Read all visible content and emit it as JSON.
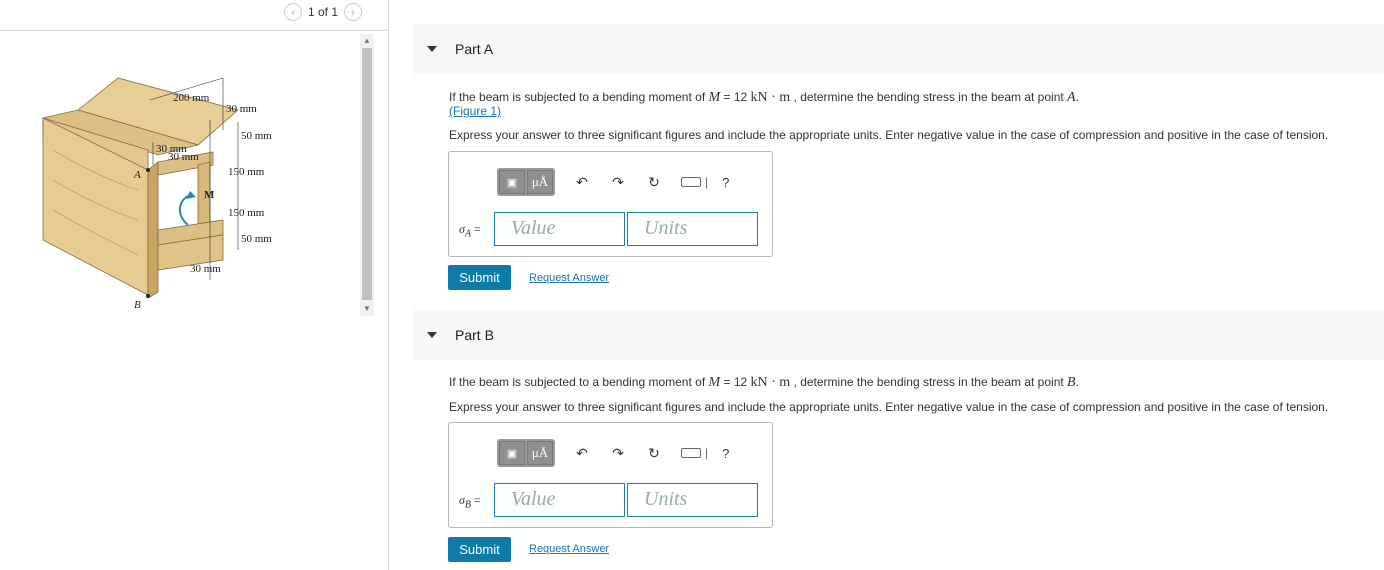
{
  "pager": {
    "prev_icon": "chevron-left-icon",
    "next_icon": "chevron-right-icon",
    "text": "1 of 1"
  },
  "figure": {
    "labels": {
      "dim_200": "200 mm",
      "dim_30_top": "30 mm",
      "dim_50_top": "50 mm",
      "dim_30_left_a": "30 mm",
      "dim_30_left_b": "30 mm",
      "dim_150_a": "150 mm",
      "dim_150_b": "150 mm",
      "dim_50_bot": "50 mm",
      "dim_30_bot": "30 mm",
      "point_a": "A",
      "point_b": "B",
      "moment": "M"
    }
  },
  "partA": {
    "title": "Part A",
    "question_pre": "If the beam is subjected to a bending moment of ",
    "question_M": "M",
    "question_eq": " = 12 ",
    "question_units": "kN · m",
    "question_mid": " , determine the bending stress in the beam at point ",
    "question_point": "A",
    "question_end": ".",
    "figure_link": "(Figure 1)",
    "instructions": "Express your answer to three significant figures and include the appropriate units. Enter negative value in the case of compression and positive in the case of tension.",
    "label_sigma": "σ",
    "label_sub": "A",
    "label_eq": " =",
    "value_placeholder": "Value",
    "units_placeholder": "Units",
    "submit": "Submit",
    "request": "Request Answer"
  },
  "partB": {
    "title": "Part B",
    "question_pre": "If the beam is subjected to a bending moment of ",
    "question_M": "M",
    "question_eq": " = 12 ",
    "question_units": "kN · m",
    "question_mid": " , determine the bending stress in the beam at point ",
    "question_point": "B",
    "question_end": ".",
    "instructions": "Express your answer to three significant figures and include the appropriate units. Enter negative value in the case of compression and positive in the case of tension.",
    "label_sigma": "σ",
    "label_sub": "B",
    "label_eq": " =",
    "value_placeholder": "Value",
    "units_placeholder": "Units",
    "submit": "Submit",
    "request": "Request Answer"
  },
  "toolbar": {
    "templates_icon": "templates-icon",
    "units_label": "μÅ",
    "undo_icon": "undo-icon",
    "redo_icon": "redo-icon",
    "reset_icon": "reset-icon",
    "keyboard_icon": "keyboard-icon",
    "help": "?"
  },
  "colors": {
    "accent": "#0e7aa7",
    "link": "#1a73b5",
    "wood": "#e2c48a",
    "wood_dark": "#c9a564"
  }
}
